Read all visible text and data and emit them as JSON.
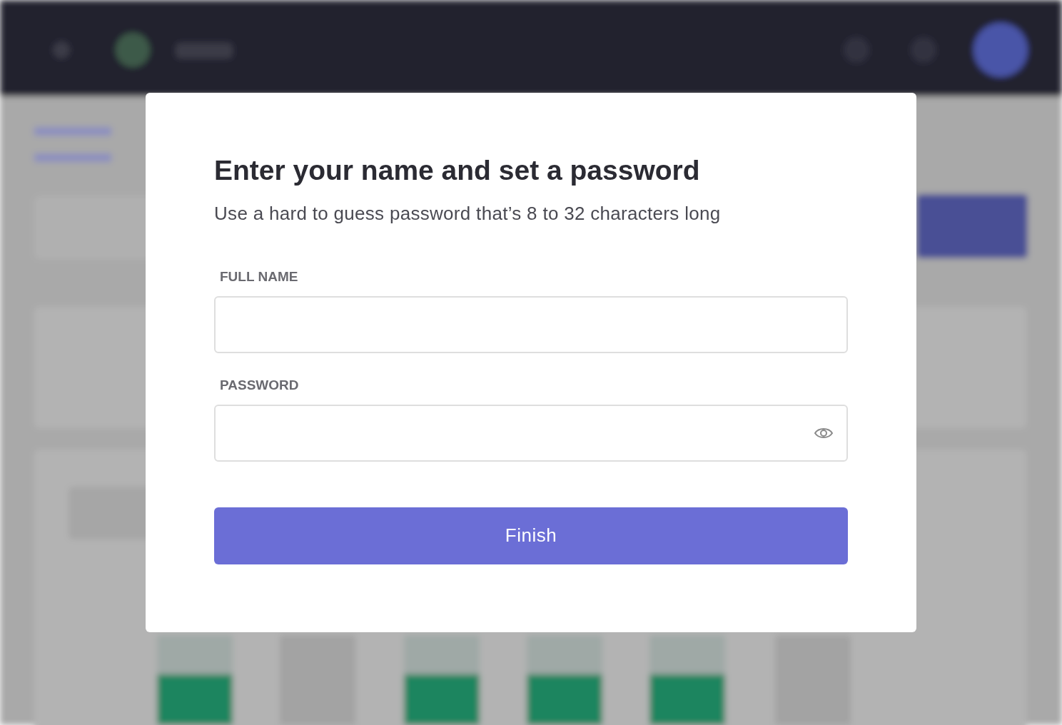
{
  "dialog": {
    "title": "Enter your name and set a password",
    "subtitle": "Use a hard to guess password that’s 8 to 32 characters long",
    "fields": [
      {
        "label": "FULL NAME",
        "kind": "text"
      },
      {
        "label": "PASSWORD",
        "kind": "password"
      }
    ],
    "button": "Finish"
  }
}
